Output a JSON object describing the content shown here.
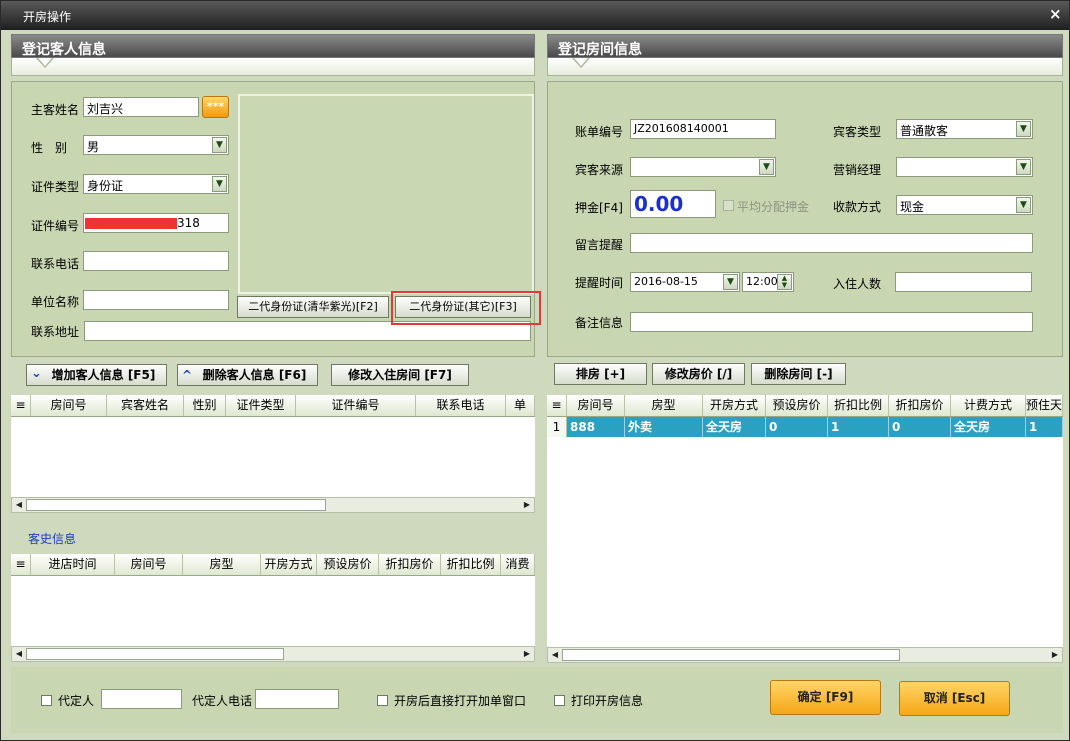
{
  "window": {
    "title": "开房操作",
    "close": "×"
  },
  "guest": {
    "header": "登记客人信息",
    "name_label": "主客姓名",
    "name_value": "刘吉兴",
    "name_btn": "***",
    "gender_label": "性　别",
    "gender_value": "男",
    "idtype_label": "证件类型",
    "idtype_value": "身份证",
    "idno_label": "证件编号",
    "idno_value": "318",
    "phone_label": "联系电话",
    "phone_value": "",
    "company_label": "单位名称",
    "company_value": "",
    "address_label": "联系地址",
    "address_value": "",
    "id_btn_f2": "二代身份证(清华紫光)[F2]",
    "id_btn_f3": "二代身份证(其它)[F3]",
    "add_btn": "增加客人信息 [F5]",
    "del_btn": "删除客人信息 [F6]",
    "edit_room_btn": "修改入住房间 [F7]",
    "grid_columns": [
      "房间号",
      "宾客姓名",
      "性别",
      "证件类型",
      "证件编号",
      "联系电话",
      "单"
    ],
    "history_label": "客史信息",
    "history_columns": [
      "进店时间",
      "房间号",
      "房型",
      "开房方式",
      "预设房价",
      "折扣房价",
      "折扣比例",
      "消费"
    ]
  },
  "room": {
    "header": "登记房间信息",
    "bill_label": "账单编号",
    "bill_value": "JZ201608140001",
    "guesttype_label": "宾客类型",
    "guesttype_value": "普通散客",
    "source_label": "宾客来源",
    "source_value": "",
    "manager_label": "营销经理",
    "manager_value": "",
    "deposit_label": "押金[F4]",
    "deposit_value": "0.00",
    "avg_deposit_label": "平均分配押金",
    "payment_label": "收款方式",
    "payment_value": "现金",
    "message_label": "留言提醒",
    "message_value": "",
    "remind_label": "提醒时间",
    "remind_date": "2016-08-15",
    "remind_time": "12:00",
    "occupants_label": "入住人数",
    "occupants_value": "",
    "notes_label": "备注信息",
    "notes_value": "",
    "arrange_btn": "排房 [+]",
    "editprice_btn": "修改房价 [/]",
    "delroom_btn": "删除房间 [-]",
    "grid_columns": [
      "房间号",
      "房型",
      "开房方式",
      "预设房价",
      "折扣比例",
      "折扣房价",
      "计费方式",
      "预住天"
    ],
    "rows": [
      {
        "index": "1",
        "room": "888",
        "type": "外卖",
        "mode": "全天房",
        "preset": "0",
        "ratio": "1",
        "discount": "0",
        "billing": "全天房",
        "days": "1"
      }
    ]
  },
  "footer": {
    "agent_label": "代定人",
    "agent_value": "",
    "agent_phone_label": "代定人电话",
    "agent_phone_value": "",
    "open_bill_label": "开房后直接打开加单窗口",
    "print_label": "打印开房信息",
    "ok_btn": "确定 [F9]",
    "cancel_btn": "取消 [Esc]"
  },
  "colors": {
    "accent_row": "#2aa1c0",
    "highlight_box": "#e23a3a",
    "redact": "#ee3333",
    "deposit_text": "#1a2fd0",
    "history_label": "#1a3fbf"
  }
}
